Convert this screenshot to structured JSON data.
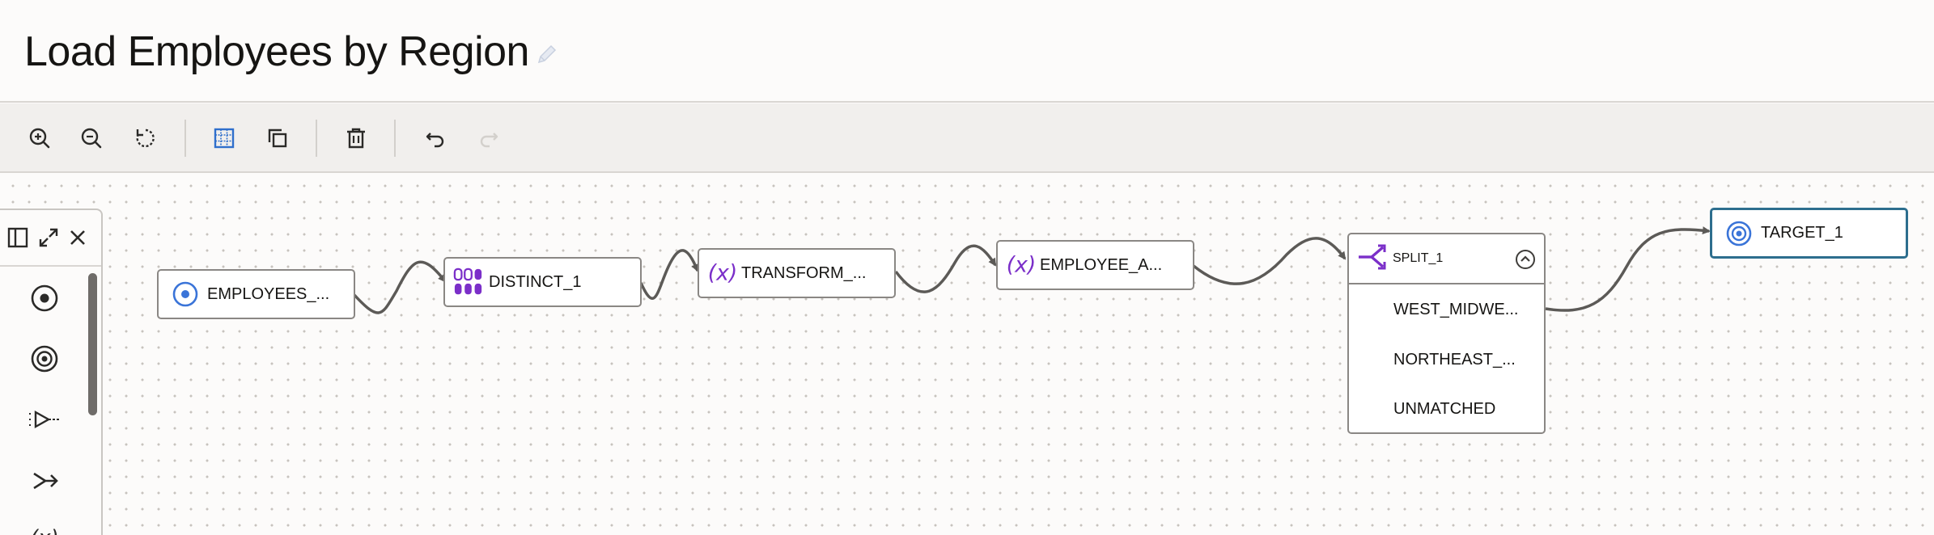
{
  "page": {
    "title": "Load Employees by Region"
  },
  "toolbar": {
    "buttons": [
      "zoom-in",
      "zoom-out",
      "reset",
      "grid",
      "duplicate",
      "delete",
      "undo",
      "redo"
    ]
  },
  "palette": {
    "items": [
      "source-operator-icon",
      "target-operator-icon",
      "filter-operator-icon",
      "join-operator-icon",
      "expression-operator-icon"
    ]
  },
  "flow": {
    "nodes": [
      {
        "id": "employees",
        "label": "EMPLOYEES_...",
        "icon": "source-icon"
      },
      {
        "id": "distinct",
        "label": "DISTINCT_1",
        "icon": "distinct-icon"
      },
      {
        "id": "transform",
        "label": "TRANSFORM_...",
        "icon": "expression-icon"
      },
      {
        "id": "employee_a",
        "label": "EMPLOYEE_A...",
        "icon": "expression-icon"
      },
      {
        "id": "split",
        "label": "SPLIT_1",
        "icon": "split-icon",
        "outputs": [
          "WEST_MIDWE...",
          "NORTHEAST_...",
          "UNMATCHED"
        ]
      },
      {
        "id": "target",
        "label": "TARGET_1",
        "icon": "target-icon"
      }
    ]
  },
  "colors": {
    "accent_purple": "#7b2fc9",
    "accent_blue": "#3a74d8",
    "selected_border": "#2d6e8e"
  }
}
